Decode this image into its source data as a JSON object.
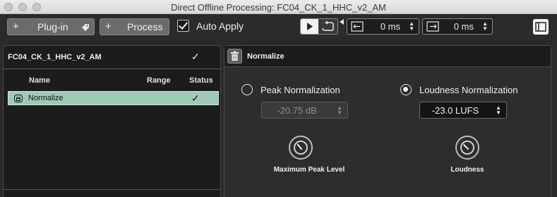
{
  "window": {
    "title": "Direct Offline Processing: FC04_CK_1_HHC_v2_AM"
  },
  "toolbar": {
    "plugin_label": "Plug-in",
    "process_label": "Process",
    "auto_apply_label": "Auto Apply",
    "auto_apply_checked": true,
    "pre_roll_value": "0 ms",
    "post_roll_value": "0 ms",
    "plus_glyph": "+"
  },
  "left_panel": {
    "title": "FC04_CK_1_HHC_v2_AM",
    "columns": [
      "Name",
      "Range",
      "Status"
    ],
    "rows": [
      {
        "name": "Normalize",
        "range": "",
        "status": "✓"
      }
    ],
    "title_status": "✓"
  },
  "right_panel": {
    "title": "Normalize",
    "peak": {
      "label": "Peak Normalization",
      "selected": false,
      "value": "-20.75 dB",
      "knob_label": "Maximum Peak Level"
    },
    "loudness": {
      "label": "Loudness Normalization",
      "selected": true,
      "value": "-23.0 LUFS",
      "knob_label": "Loudness"
    }
  },
  "colors": {
    "accent_row": "#9fcab5",
    "panel_bg": "#2d2d2d",
    "list_bg": "#1c1c1c"
  },
  "icons": [
    "plus-icon",
    "plugin-preset-icon",
    "play-icon",
    "loop-icon",
    "pre-roll-icon",
    "post-roll-icon",
    "panel-toggle-icon",
    "trash-icon",
    "effect-icon",
    "check-icon",
    "knob-icon"
  ]
}
